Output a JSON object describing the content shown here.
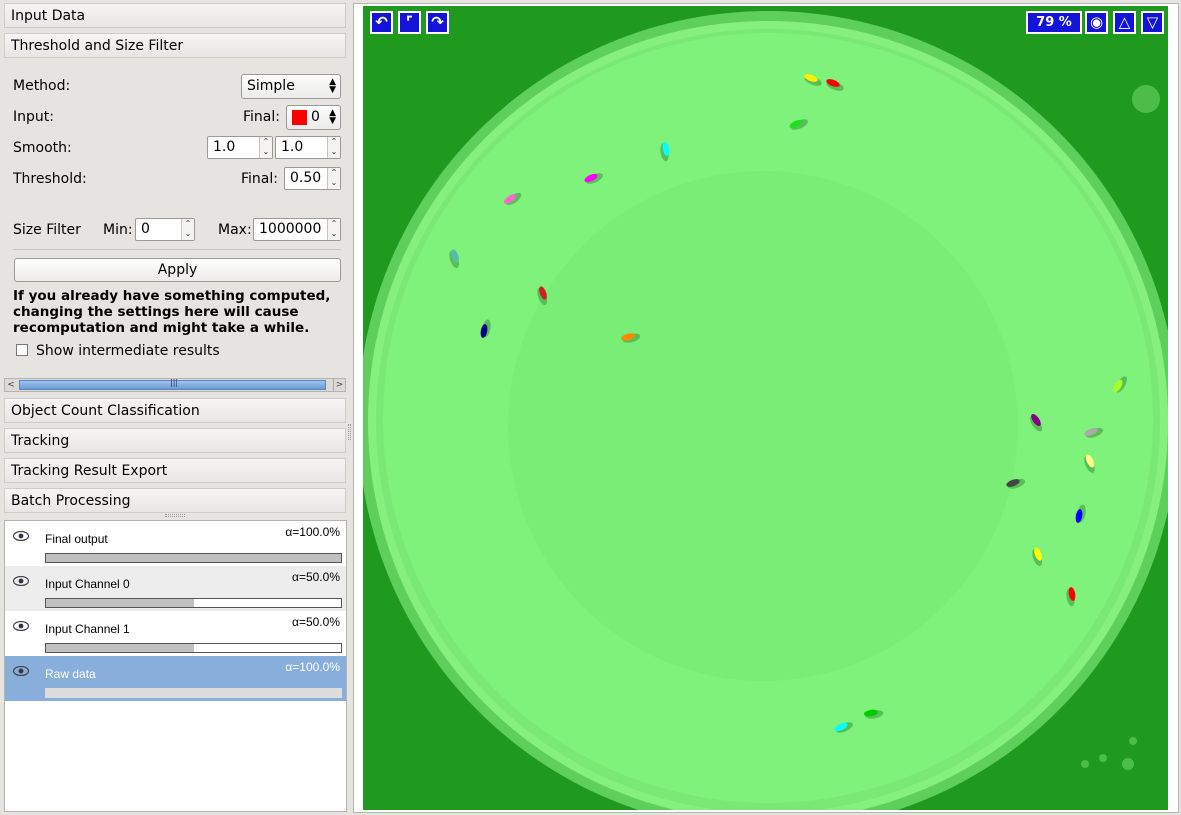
{
  "sections": {
    "input_data": "Input Data",
    "threshold": "Threshold and Size Filter",
    "object_count": "Object Count Classification",
    "tracking": "Tracking",
    "export": "Tracking Result Export",
    "batch": "Batch Processing"
  },
  "threshold": {
    "method_label": "Method:",
    "method_value": "Simple",
    "input_label": "Input:",
    "final_label": "Final:",
    "final_channel": "0",
    "final_color": "#ff0000",
    "smooth_label": "Smooth:",
    "smooth_x": "1.0",
    "smooth_y": "1.0",
    "threshold_label": "Threshold:",
    "threshold_final_label": "Final:",
    "threshold_value": "0.50",
    "size_filter_label": "Size Filter",
    "min_label": "Min:",
    "min_value": "0",
    "max_label": "Max:",
    "max_value": "1000000",
    "apply_label": "Apply",
    "warning": "If you already have something computed, changing the settings here will cause recomputation and might take a while.",
    "show_intermediate": "Show intermediate results",
    "show_intermediate_checked": false
  },
  "layers": [
    {
      "name": "Final output",
      "alpha": "α=100.0%",
      "opacity": 1.0,
      "selected": false
    },
    {
      "name": "Input Channel 0",
      "alpha": "α=50.0%",
      "opacity": 0.5,
      "selected": false
    },
    {
      "name": "Input Channel 1",
      "alpha": "α=50.0%",
      "opacity": 0.5,
      "selected": false
    },
    {
      "name": "Raw data",
      "alpha": "α=100.0%",
      "opacity": 1.0,
      "selected": true
    }
  ],
  "viewer": {
    "zoom": "79 %",
    "tools_left": [
      "undo-icon",
      "fit-icon",
      "redo-icon"
    ],
    "tools_right": [
      "camera-icon",
      "up-triangle-icon",
      "down-triangle-icon"
    ],
    "background_color": "#1f9a1f",
    "dish_color": "#7ef27a"
  },
  "objects": [
    {
      "color": "#ffee00"
    },
    {
      "color": "#ff0000"
    },
    {
      "color": "#22dd22"
    },
    {
      "color": "#00ffff"
    },
    {
      "color": "#ff00ff"
    },
    {
      "color": "#ff66cc"
    },
    {
      "color": "#55bbaa"
    },
    {
      "color": "#cc2222"
    },
    {
      "color": "#000088"
    },
    {
      "color": "#ff8800"
    },
    {
      "color": "#aaff22"
    },
    {
      "color": "#880088"
    },
    {
      "color": "#aaaaaa"
    },
    {
      "color": "#ffff88"
    },
    {
      "color": "#444444"
    },
    {
      "color": "#0000ff"
    },
    {
      "color": "#ffff00"
    },
    {
      "color": "#ff0000"
    },
    {
      "color": "#00ffff"
    },
    {
      "color": "#00cc00"
    }
  ]
}
